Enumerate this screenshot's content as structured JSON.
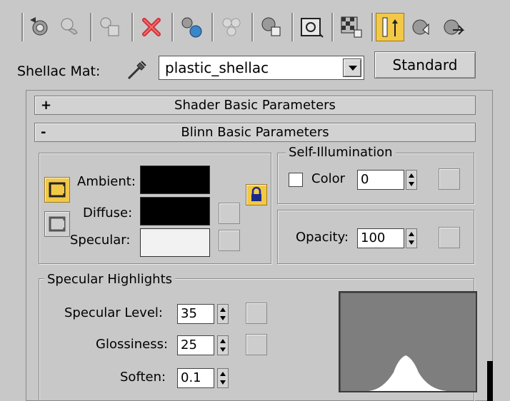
{
  "toolbar": {
    "icons": [
      "get-material-icon",
      "put-to-scene-icon",
      "assign-to-selection-icon",
      "delete-icon",
      "make-copy-icon",
      "make-unique-icon",
      "put-to-library-icon",
      "material-id-channel-icon",
      "show-map-in-viewport-icon",
      "show-end-result-icon",
      "go-to-parent-icon",
      "go-forward-to-sibling-icon"
    ],
    "active_icon": "show-end-result-icon",
    "accent_color": "#f2c846"
  },
  "material": {
    "label": "Shellac Mat:",
    "name": "plastic_shellac",
    "type_button": "Standard"
  },
  "rollouts": {
    "shader_basic": {
      "sign": "+",
      "title": "Shader Basic Parameters"
    },
    "blinn_basic": {
      "sign": "-",
      "title": "Blinn Basic Parameters"
    }
  },
  "colors": {
    "ambient_label": "Ambient:",
    "diffuse_label": "Diffuse:",
    "specular_label": "Specular:",
    "ambient_color": "#000000",
    "diffuse_color": "#000000",
    "specular_color": "#f2f2f2"
  },
  "self_illumination": {
    "legend": "Self-Illumination",
    "checkbox_label": "Color",
    "value": "0"
  },
  "opacity": {
    "label": "Opacity:",
    "value": "100"
  },
  "specular_highlights": {
    "legend": "Specular Highlights",
    "level_label": "Specular Level:",
    "level_value": "35",
    "glossiness_label": "Glossiness:",
    "glossiness_value": "25",
    "soften_label": "Soften:",
    "soften_value": "0.1"
  }
}
